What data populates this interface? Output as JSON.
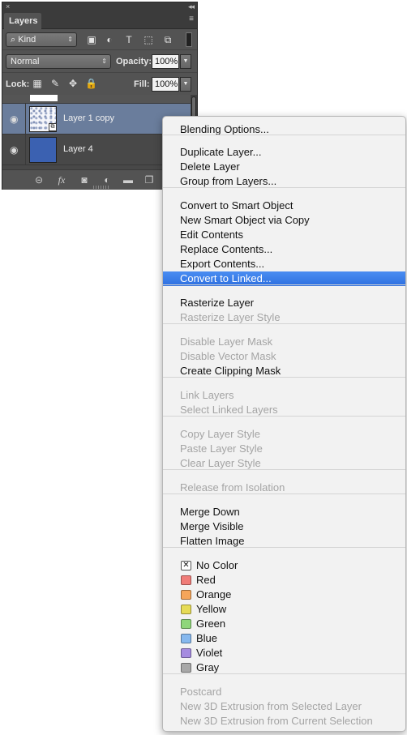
{
  "panel": {
    "close_glyph": "×",
    "collapse_glyph": "◂◂",
    "tab_label": "Layers",
    "menu_glyph": "≡",
    "filter": {
      "kind_label": "Kind",
      "search_glyph": "⌕",
      "arrow": "⇕",
      "icons": [
        "▣",
        "◐",
        "T",
        "⬚",
        "⧉"
      ]
    },
    "blend": {
      "mode": "Normal",
      "arrow": "⇕",
      "opacity_label": "Opacity:",
      "opacity_value": "100%",
      "spin_arrow": "▼"
    },
    "lock": {
      "label": "Lock:",
      "icons": [
        "▦",
        "✎",
        "✥",
        "🔒"
      ],
      "fill_label": "Fill:",
      "fill_value": "100%",
      "spin_arrow": "▼"
    },
    "layers": [
      {
        "name": "Layer 1 copy",
        "selected": true,
        "eye": "◉",
        "badge": "⧉"
      },
      {
        "name": "Layer 4",
        "selected": false,
        "eye": "◉"
      }
    ],
    "footer_icons": [
      "⊝",
      "fx",
      "◙",
      "◐",
      "▬",
      "❐"
    ]
  },
  "menu": {
    "items": [
      {
        "label": "Blending Options...",
        "enabled": true
      },
      {
        "separator": true
      },
      {
        "label": "Duplicate Layer...",
        "enabled": true
      },
      {
        "label": "Delete Layer",
        "enabled": true
      },
      {
        "label": "Group from Layers...",
        "enabled": true
      },
      {
        "separator": true
      },
      {
        "label": "Convert to Smart Object",
        "enabled": true
      },
      {
        "label": "New Smart Object via Copy",
        "enabled": true
      },
      {
        "label": "Edit Contents",
        "enabled": true
      },
      {
        "label": "Replace Contents...",
        "enabled": true
      },
      {
        "label": "Export Contents...",
        "enabled": true
      },
      {
        "label": "Convert to Linked...",
        "enabled": true,
        "highlighted": true
      },
      {
        "separator": true
      },
      {
        "label": "Rasterize Layer",
        "enabled": true
      },
      {
        "label": "Rasterize Layer Style",
        "enabled": false
      },
      {
        "separator": true
      },
      {
        "label": "Disable Layer Mask",
        "enabled": false
      },
      {
        "label": "Disable Vector Mask",
        "enabled": false
      },
      {
        "label": "Create Clipping Mask",
        "enabled": true
      },
      {
        "separator": true
      },
      {
        "label": "Link Layers",
        "enabled": false
      },
      {
        "label": "Select Linked Layers",
        "enabled": false
      },
      {
        "separator": true
      },
      {
        "label": "Copy Layer Style",
        "enabled": false
      },
      {
        "label": "Paste Layer Style",
        "enabled": false
      },
      {
        "label": "Clear Layer Style",
        "enabled": false
      },
      {
        "separator": true
      },
      {
        "label": "Release from Isolation",
        "enabled": false
      },
      {
        "separator": true
      },
      {
        "label": "Merge Down",
        "enabled": true
      },
      {
        "label": "Merge Visible",
        "enabled": true
      },
      {
        "label": "Flatten Image",
        "enabled": true
      },
      {
        "separator": true
      },
      {
        "label": "No Color",
        "enabled": true,
        "swatch": "none",
        "swatch_glyph": "✕"
      },
      {
        "label": "Red",
        "enabled": true,
        "swatch": "#f07c78"
      },
      {
        "label": "Orange",
        "enabled": true,
        "swatch": "#f5a55a"
      },
      {
        "label": "Yellow",
        "enabled": true,
        "swatch": "#e6db55"
      },
      {
        "label": "Green",
        "enabled": true,
        "swatch": "#8fd67a"
      },
      {
        "label": "Blue",
        "enabled": true,
        "swatch": "#86b8ee"
      },
      {
        "label": "Violet",
        "enabled": true,
        "swatch": "#a58be0"
      },
      {
        "label": "Gray",
        "enabled": true,
        "swatch": "#a8a8a8"
      },
      {
        "separator": true
      },
      {
        "label": "Postcard",
        "enabled": false
      },
      {
        "label": "New 3D Extrusion from Selected Layer",
        "enabled": false
      },
      {
        "label": "New 3D Extrusion from Current Selection",
        "enabled": false
      }
    ]
  }
}
